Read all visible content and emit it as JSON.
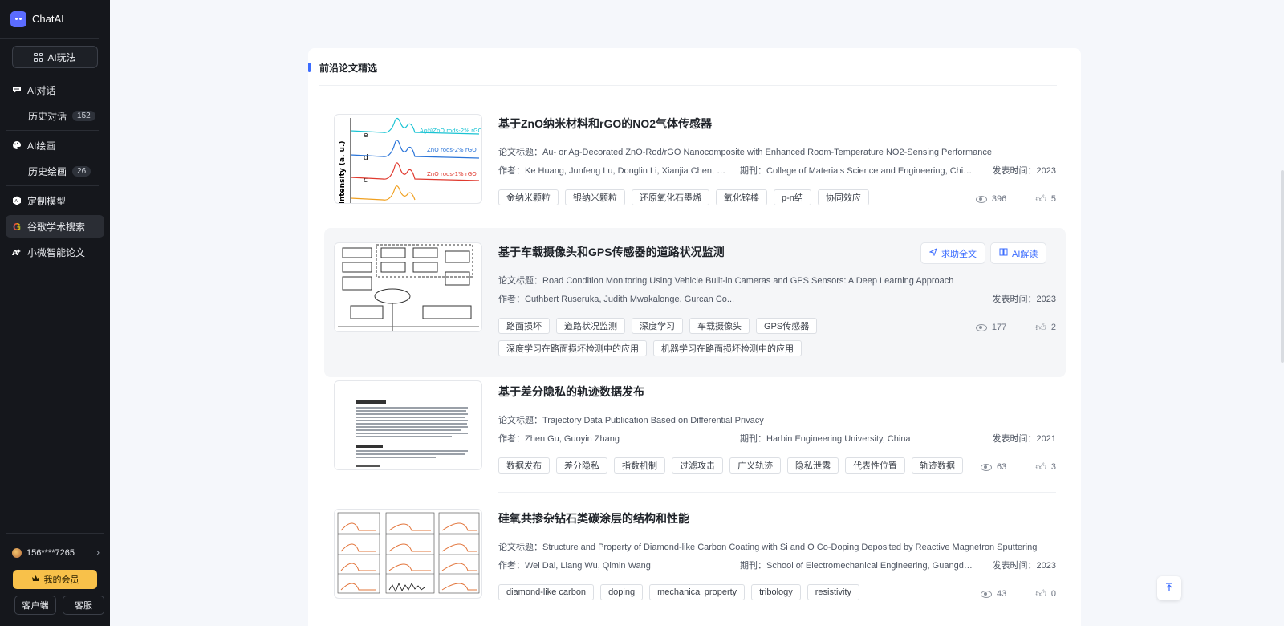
{
  "app": {
    "name": "ChatAI"
  },
  "sidebar": {
    "ai_play": "AI玩法",
    "items": [
      {
        "label": "AI对话",
        "icon": "chat-icon"
      },
      {
        "label": "历史对话",
        "badge": "152"
      },
      {
        "label": "AI绘画",
        "icon": "palette-icon"
      },
      {
        "label": "历史绘画",
        "badge": "26"
      },
      {
        "label": "定制模型",
        "icon": "model-icon"
      },
      {
        "label": "谷歌学术搜索",
        "icon": "google-icon"
      },
      {
        "label": "小微智能论文",
        "icon": "ai-paper-icon"
      }
    ],
    "user": "156****7265",
    "member": "我的会员",
    "client_btn": "客户端",
    "service_btn": "客服"
  },
  "section": {
    "title": "前沿论文精选"
  },
  "labels": {
    "paper_title": "论文标题：",
    "author": "作者：",
    "journal": "期刊：",
    "published": "发表时间："
  },
  "papers": [
    {
      "title": "基于ZnO纳米材料和rGO的NO2气体传感器",
      "paper_title": "Au- or Ag-Decorated ZnO-Rod/rGO Nanocomposite with Enhanced Room-Temperature NO2-Sensing Performance",
      "authors": "Ke Huang, Junfeng Lu, Donglin Li, Xianjia Chen, Din...",
      "journal": "College of Materials Science and Engineering, China...",
      "year": "2023",
      "tags": [
        "金纳米颗粒",
        "银纳米颗粒",
        "还原氧化石墨烯",
        "氧化锌棒",
        "p-n结",
        "协同效应"
      ],
      "views": "396",
      "likes": "5"
    },
    {
      "title": "基于车载摄像头和GPS传感器的道路状况监测",
      "paper_title": "Road Condition Monitoring Using Vehicle Built-in Cameras and GPS Sensors: A Deep Learning Approach",
      "authors": "Cuthbert Ruseruka, Judith Mwakalonge, Gurcan Co...",
      "journal": "",
      "year": "2023",
      "tags": [
        "路面损坏",
        "道路状况监测",
        "深度学习",
        "车载摄像头",
        "GPS传感器",
        "深度学习在路面损坏检测中的应用",
        "机器学习在路面损坏检测中的应用"
      ],
      "views": "177",
      "likes": "2",
      "btn_fulltext": "求助全文",
      "btn_ai_read": "AI解读"
    },
    {
      "title": "基于差分隐私的轨迹数据发布",
      "paper_title": "Trajectory Data Publication Based on Differential Privacy",
      "authors": "Zhen Gu, Guoyin Zhang",
      "journal": "Harbin Engineering University, China",
      "year": "2021",
      "tags": [
        "数据发布",
        "差分隐私",
        "指数机制",
        "过滤攻击",
        "广义轨迹",
        "隐私泄露",
        "代表性位置",
        "轨迹数据"
      ],
      "views": "63",
      "likes": "3"
    },
    {
      "title": "硅氧共掺杂钻石类碳涂层的结构和性能",
      "paper_title": "Structure and Property of Diamond-like Carbon Coating with Si and O Co-Doping Deposited by Reactive Magnetron Sputtering",
      "authors": "Wei Dai, Liang Wu, Qimin Wang",
      "journal": "School of Electromechanical Engineering, Guangdo...",
      "year": "2023",
      "tags": [
        "diamond-like carbon",
        "doping",
        "mechanical property",
        "tribology",
        "resistivity"
      ],
      "views": "43",
      "likes": "0"
    }
  ],
  "thumb1": {
    "ylabel": "Intensity (a. u.)",
    "legend": [
      "Ag@ZnO rods-2% rGO",
      "ZnO rods-2% rGO",
      "ZnO rods-1% rGO"
    ],
    "letters": [
      "e",
      "d",
      "c"
    ]
  },
  "colors": {
    "accent": "#3b6cff",
    "sidebar_bg": "#15171c",
    "member": "#f8c14a"
  }
}
